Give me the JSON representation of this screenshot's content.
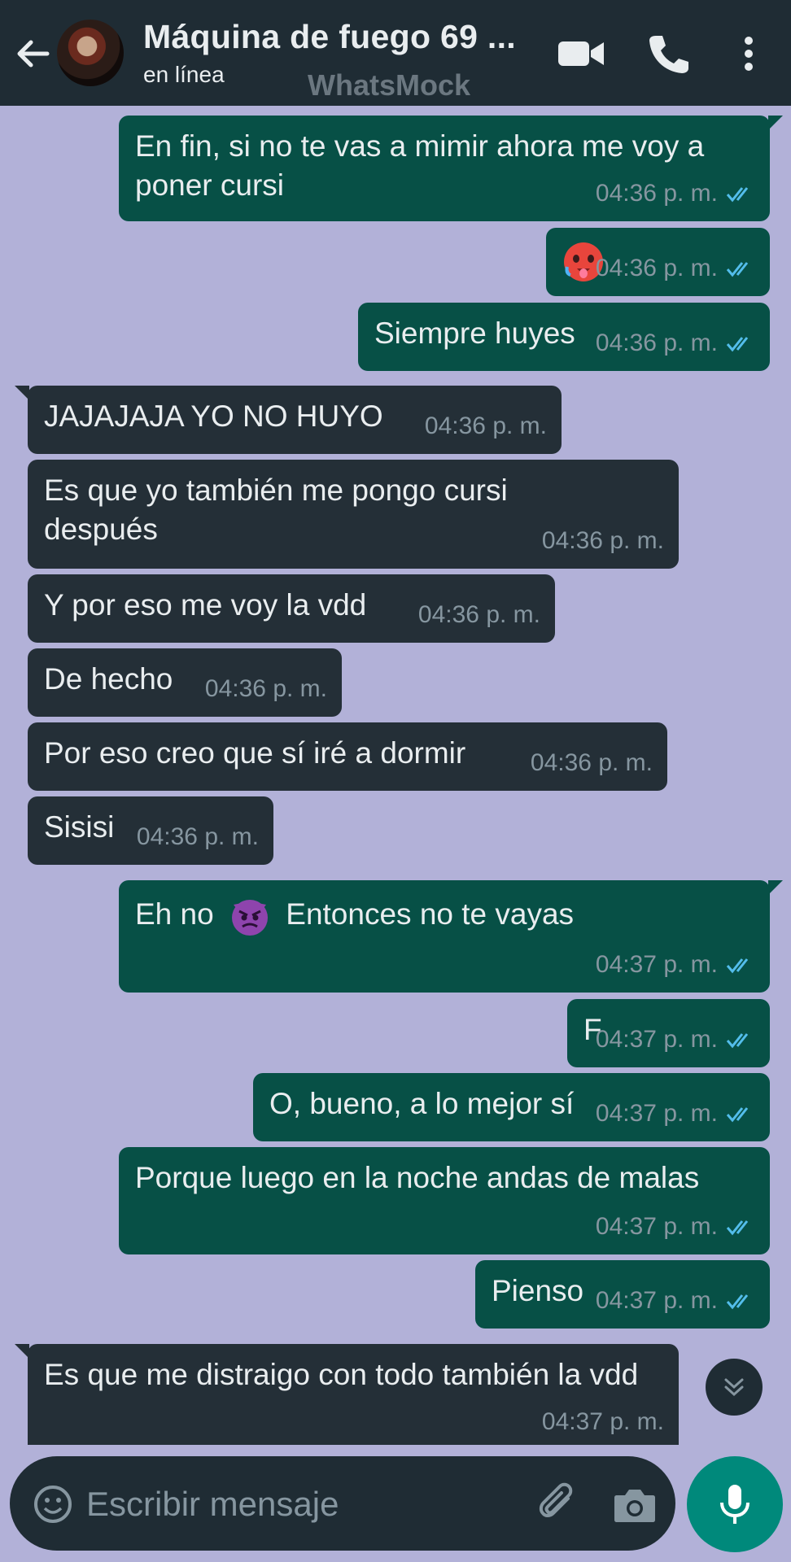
{
  "header": {
    "title": "Máquina de fuego 69 ...",
    "status": "en línea",
    "watermark": "WhatsMock"
  },
  "messages": [
    {
      "dir": "out",
      "text": "En fin, si no te vas a mimir ahora me voy a poner cursi",
      "time": "04:36 p. m."
    },
    {
      "dir": "out",
      "emoji": "hot-face-emoji",
      "time": "04:36 p. m."
    },
    {
      "dir": "out",
      "text": "Siempre huyes",
      "time": "04:36 p. m."
    },
    {
      "dir": "in",
      "text": "JAJAJAJA YO NO HUYO",
      "time": "04:36 p. m."
    },
    {
      "dir": "in",
      "text": "Es que yo también me pongo cursi después",
      "time": "04:36 p. m."
    },
    {
      "dir": "in",
      "text": "Y por eso me voy la vdd",
      "time": "04:36 p. m."
    },
    {
      "dir": "in",
      "text": "De hecho",
      "time": "04:36 p. m."
    },
    {
      "dir": "in",
      "text": "Por eso creo que sí iré a dormir",
      "time": "04:36 p. m."
    },
    {
      "dir": "in",
      "text": "Sisisi",
      "time": "04:36 p. m."
    },
    {
      "dir": "out",
      "text_before": "Eh no",
      "emoji": "angry-devil-emoji",
      "text_after": "Entonces no te vayas",
      "time": "04:37 p. m."
    },
    {
      "dir": "out",
      "text": "F",
      "time": "04:37 p. m."
    },
    {
      "dir": "out",
      "text": "O, bueno, a lo mejor sí",
      "time": "04:37 p. m."
    },
    {
      "dir": "out",
      "text": "Porque luego en la noche andas de malas",
      "time": "04:37 p. m."
    },
    {
      "dir": "out",
      "text": "Pienso",
      "time": "04:37 p. m."
    },
    {
      "dir": "in",
      "text": "Es que me distraigo con todo también la vdd",
      "time": "04:37 p. m."
    }
  ],
  "input": {
    "placeholder": "Escribir mensaje"
  },
  "colors": {
    "chat_background": "#b2b1d8",
    "outgoing_bubble": "#075046",
    "incoming_bubble": "#242f37",
    "header": "#1f2c34",
    "read_ticks": "#53bdeb",
    "mic_button": "#00897b"
  }
}
